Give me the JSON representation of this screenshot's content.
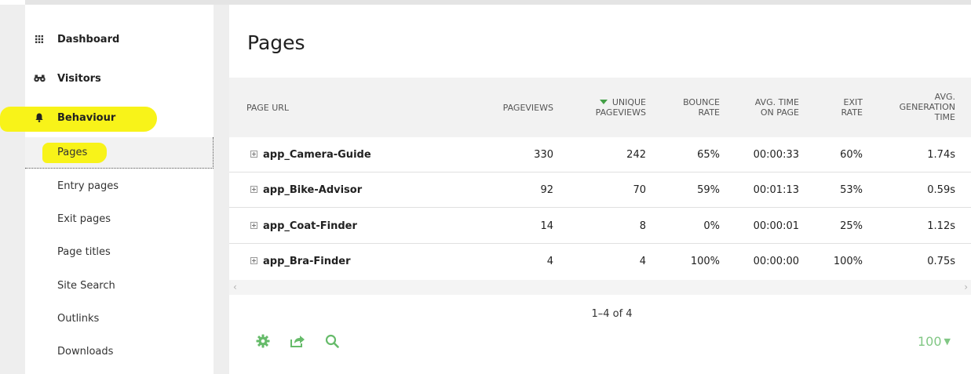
{
  "sidebar": {
    "categories": [
      {
        "label": "Dashboard",
        "icon": "grid-icon"
      },
      {
        "label": "Visitors",
        "icon": "binoculars-icon"
      },
      {
        "label": "Behaviour",
        "icon": "bell-icon"
      }
    ],
    "subitems": [
      {
        "label": "Pages",
        "active": true
      },
      {
        "label": "Entry pages"
      },
      {
        "label": "Exit pages"
      },
      {
        "label": "Page titles"
      },
      {
        "label": "Site Search"
      },
      {
        "label": "Outlinks"
      },
      {
        "label": "Downloads"
      }
    ],
    "highlight_color": "#f8f319"
  },
  "main": {
    "title": "Pages",
    "columns": {
      "url": "Page URL",
      "pageviews": "Pageviews",
      "unique_1": "Unique",
      "unique_2": "Pageviews",
      "bounce_1": "Bounce",
      "bounce_2": "Rate",
      "avgtime_1": "Avg. time",
      "avgtime_2": "on page",
      "exit_1": "Exit",
      "exit_2": "rate",
      "gen_1": "Avg.",
      "gen_2": "generation",
      "gen_3": "time"
    },
    "rows": [
      {
        "url": "app_Camera-Guide",
        "pageviews": "330",
        "unique": "242",
        "bounce": "65%",
        "avgtime": "00:00:33",
        "exit": "60%",
        "gen": "1.74s"
      },
      {
        "url": "app_Bike-Advisor",
        "pageviews": "92",
        "unique": "70",
        "bounce": "59%",
        "avgtime": "00:01:13",
        "exit": "53%",
        "gen": "0.59s"
      },
      {
        "url": "app_Coat-Finder",
        "pageviews": "14",
        "unique": "8",
        "bounce": "0%",
        "avgtime": "00:00:01",
        "exit": "25%",
        "gen": "1.12s"
      },
      {
        "url": "app_Bra-Finder",
        "pageviews": "4",
        "unique": "4",
        "bounce": "100%",
        "avgtime": "00:00:00",
        "exit": "100%",
        "gen": "0.75s"
      }
    ],
    "pagination": "1–4 of 4",
    "limit": "100",
    "footer_icons": [
      "gear-icon",
      "export-icon",
      "search-icon"
    ],
    "accent": "#43a047"
  }
}
